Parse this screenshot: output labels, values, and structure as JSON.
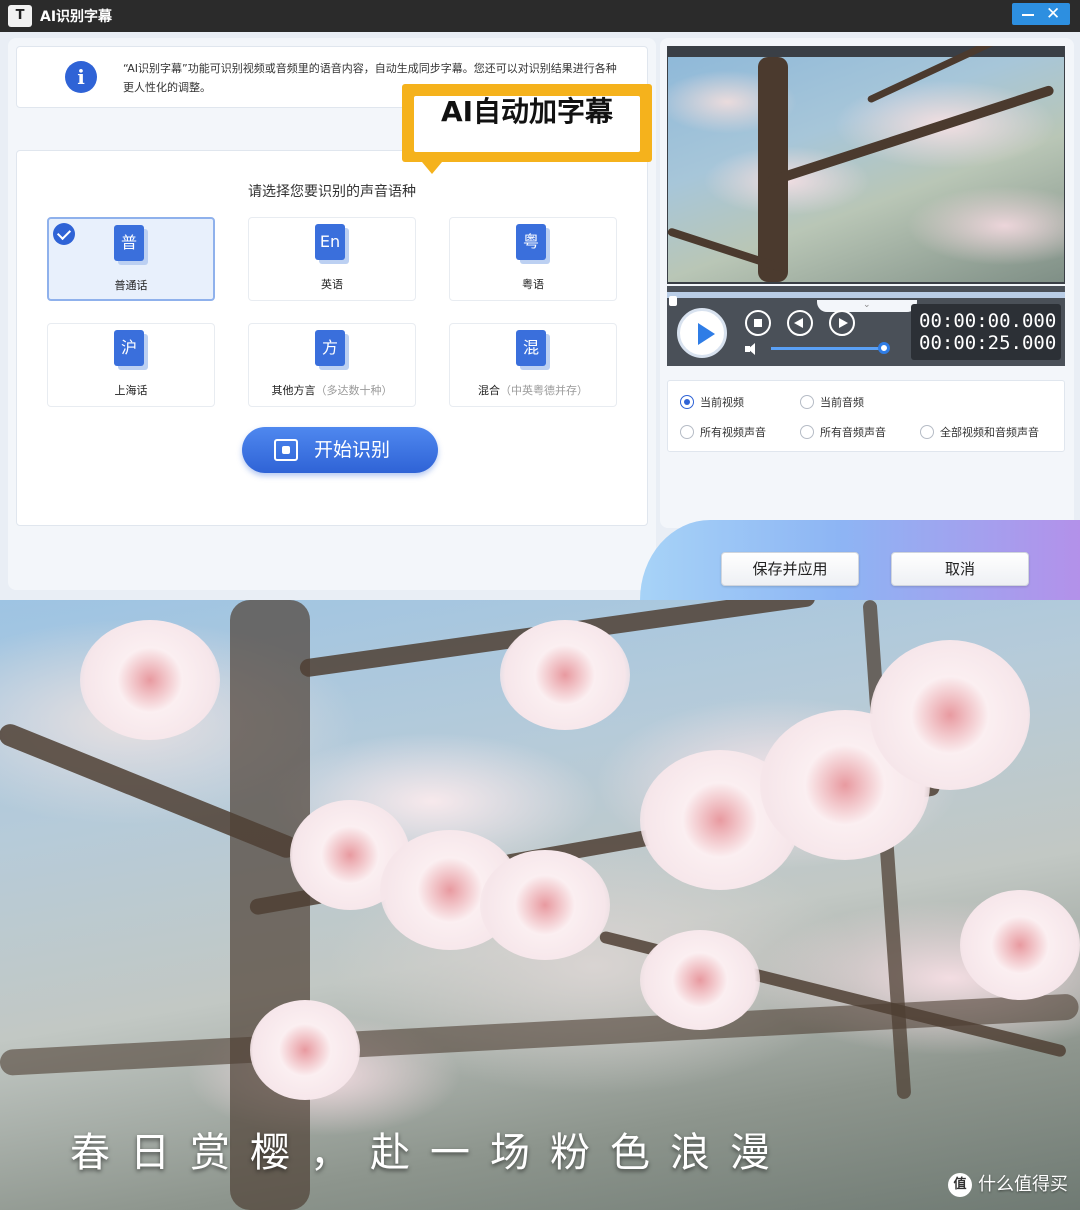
{
  "window": {
    "title": "AI识别字幕",
    "logo_glyph": "T"
  },
  "info": {
    "text": "“AI识别字幕”功能可识别视频或音频里的语音内容，自动生成同步字幕。您还可以对识别结果进行各种更人性化的调整。"
  },
  "callout": {
    "text": "AI自动加字幕",
    "color": "#f5b21c"
  },
  "language_select": {
    "title": "请选择您要识别的声音语种",
    "options": [
      {
        "glyph": "普",
        "label": "普通话",
        "hint": "",
        "selected": true
      },
      {
        "glyph": "En",
        "label": "英语",
        "hint": "",
        "selected": false
      },
      {
        "glyph": "粤",
        "label": "粤语",
        "hint": "",
        "selected": false
      },
      {
        "glyph": "沪",
        "label": "上海话",
        "hint": "",
        "selected": false
      },
      {
        "glyph": "方",
        "label": "其他方言",
        "hint": "（多达数十种）",
        "selected": false
      },
      {
        "glyph": "混",
        "label": "混合",
        "hint": "（中英粤德并存）",
        "selected": false
      }
    ],
    "start_button": "开始识别"
  },
  "player": {
    "time_current": "00:00:00.000",
    "time_total": "00:00:25.000",
    "progress": 0.0,
    "volume": 1.0
  },
  "audio_source": {
    "options": [
      {
        "label": "当前视频",
        "selected": true
      },
      {
        "label": "当前音频",
        "selected": false
      },
      {
        "label": "所有视频声音",
        "selected": false
      },
      {
        "label": "所有音频声音",
        "selected": false
      },
      {
        "label": "全部视频和音频声音",
        "selected": false
      }
    ]
  },
  "footer": {
    "save_label": "保存并应用",
    "cancel_label": "取消"
  },
  "preview": {
    "subtitle": "春日赏樱，赴一场粉色浪漫",
    "watermark": "什么值得买",
    "watermark_logo": "值"
  },
  "colors": {
    "accent": "#2f63d6",
    "titlebar": "#2b2b2b",
    "callout": "#f5b21c"
  }
}
